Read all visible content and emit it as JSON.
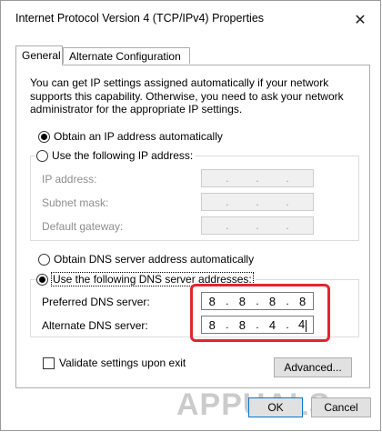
{
  "window": {
    "title": "Internet Protocol Version 4 (TCP/IPv4) Properties",
    "close_glyph": "✕"
  },
  "tabs": [
    {
      "label": "General"
    },
    {
      "label": "Alternate Configuration"
    }
  ],
  "description": "You can get IP settings assigned automatically if your network supports this capability. Otherwise, you need to ask your network administrator for the appropriate IP settings.",
  "ip": {
    "auto_label": "Obtain an IP address automatically",
    "manual_label": "Use the following IP address:",
    "selected": "auto",
    "fields": [
      {
        "label": "IP address:",
        "segments": [
          "",
          "",
          "",
          ""
        ]
      },
      {
        "label": "Subnet mask:",
        "segments": [
          "",
          "",
          "",
          ""
        ]
      },
      {
        "label": "Default gateway:",
        "segments": [
          "",
          "",
          "",
          ""
        ]
      }
    ]
  },
  "dns": {
    "auto_label": "Obtain DNS server address automatically",
    "manual_label": "Use the following DNS server addresses:",
    "selected": "manual",
    "preferred": {
      "label": "Preferred DNS server:",
      "segments": [
        "8",
        "8",
        "8",
        "8"
      ]
    },
    "alternate": {
      "label": "Alternate DNS server:",
      "segments": [
        "8",
        "8",
        "4",
        "4"
      ]
    }
  },
  "validate": {
    "label": "Validate settings upon exit",
    "checked": false
  },
  "buttons": {
    "advanced": "Advanced...",
    "ok": "OK",
    "cancel": "Cancel"
  },
  "watermark": {
    "text": "APPUALS"
  },
  "colors": {
    "highlight": "#e3262b",
    "disabled_text": "#8d8d8d"
  }
}
